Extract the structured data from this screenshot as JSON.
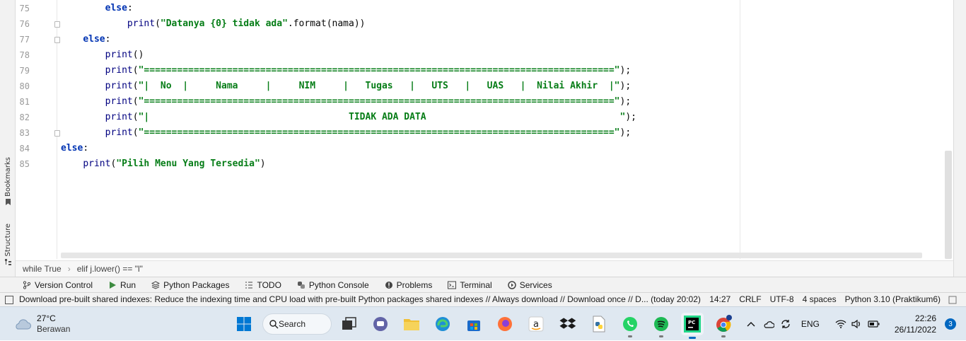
{
  "editor": {
    "line_numbers": [
      "75",
      "76",
      "77",
      "78",
      "79",
      "80",
      "81",
      "82",
      "83",
      "84",
      "85"
    ],
    "lines": [
      {
        "indent": "        ",
        "parts": [
          {
            "t": "kw",
            "v": "else"
          },
          {
            "t": "plain",
            "v": ":"
          }
        ]
      },
      {
        "indent": "            ",
        "parts": [
          {
            "t": "fn",
            "v": "print"
          },
          {
            "t": "plain",
            "v": "("
          },
          {
            "t": "str",
            "v": "\"Datanya {0} tidak ada\""
          },
          {
            "t": "plain",
            "v": ".format(nama))"
          }
        ]
      },
      {
        "indent": "    ",
        "parts": [
          {
            "t": "kw",
            "v": "else"
          },
          {
            "t": "plain",
            "v": ":"
          }
        ]
      },
      {
        "indent": "        ",
        "parts": [
          {
            "t": "fn",
            "v": "print"
          },
          {
            "t": "plain",
            "v": "()"
          }
        ]
      },
      {
        "indent": "        ",
        "parts": [
          {
            "t": "fn",
            "v": "print"
          },
          {
            "t": "plain",
            "v": "("
          },
          {
            "t": "str",
            "v": "\"=====================================================================================\""
          },
          {
            "t": "plain",
            "v": ");"
          }
        ]
      },
      {
        "indent": "        ",
        "parts": [
          {
            "t": "fn",
            "v": "print"
          },
          {
            "t": "plain",
            "v": "("
          },
          {
            "t": "str",
            "v": "\"|  No  |     Nama     |     NIM     |   Tugas   |   UTS   |   UAS   |  Nilai Akhir  |\""
          },
          {
            "t": "plain",
            "v": ");"
          }
        ]
      },
      {
        "indent": "        ",
        "parts": [
          {
            "t": "fn",
            "v": "print"
          },
          {
            "t": "plain",
            "v": "("
          },
          {
            "t": "str",
            "v": "\"=====================================================================================\""
          },
          {
            "t": "plain",
            "v": ");"
          }
        ]
      },
      {
        "indent": "        ",
        "parts": [
          {
            "t": "fn",
            "v": "print"
          },
          {
            "t": "plain",
            "v": "("
          },
          {
            "t": "str",
            "v": "\"|                                    TIDAK ADA DATA                                   \""
          },
          {
            "t": "plain",
            "v": ");"
          }
        ]
      },
      {
        "indent": "        ",
        "parts": [
          {
            "t": "fn",
            "v": "print"
          },
          {
            "t": "plain",
            "v": "("
          },
          {
            "t": "str",
            "v": "\"=====================================================================================\""
          },
          {
            "t": "plain",
            "v": ");"
          }
        ]
      },
      {
        "indent": "",
        "parts": [
          {
            "t": "kw",
            "v": "else"
          },
          {
            "t": "plain",
            "v": ":"
          }
        ]
      },
      {
        "indent": "    ",
        "parts": [
          {
            "t": "fn",
            "v": "print"
          },
          {
            "t": "plain",
            "v": "("
          },
          {
            "t": "str",
            "v": "\"Pilih Menu Yang Tersedia\""
          },
          {
            "t": "plain",
            "v": ")"
          }
        ]
      }
    ]
  },
  "side_tabs": {
    "bookmarks": "Bookmarks",
    "structure": "Structure"
  },
  "breadcrumb": {
    "item1": "while True",
    "item2": "elif j.lower() == \"l\""
  },
  "tool_windows": {
    "version_control": "Version Control",
    "run": "Run",
    "python_packages": "Python Packages",
    "todo": "TODO",
    "python_console": "Python Console",
    "problems": "Problems",
    "terminal": "Terminal",
    "services": "Services"
  },
  "status": {
    "message": "Download pre-built shared indexes: Reduce the indexing time and CPU load with pre-built Python packages shared indexes // Always download // Download once // D... (today 20:02)",
    "position": "14:27",
    "line_ending": "CRLF",
    "encoding": "UTF-8",
    "indent": "4 spaces",
    "interpreter": "Python 3.10 (Praktikum6)"
  },
  "taskbar": {
    "weather_temp": "27°C",
    "weather_desc": "Berawan",
    "search_label": "Search",
    "language": "ENG",
    "time": "22:26",
    "date": "26/11/2022",
    "notification_count": "3",
    "colors": {
      "accent": "#0067c0",
      "pycharm": "#21d789",
      "spotify": "#1db954",
      "whatsapp": "#25d366"
    }
  }
}
